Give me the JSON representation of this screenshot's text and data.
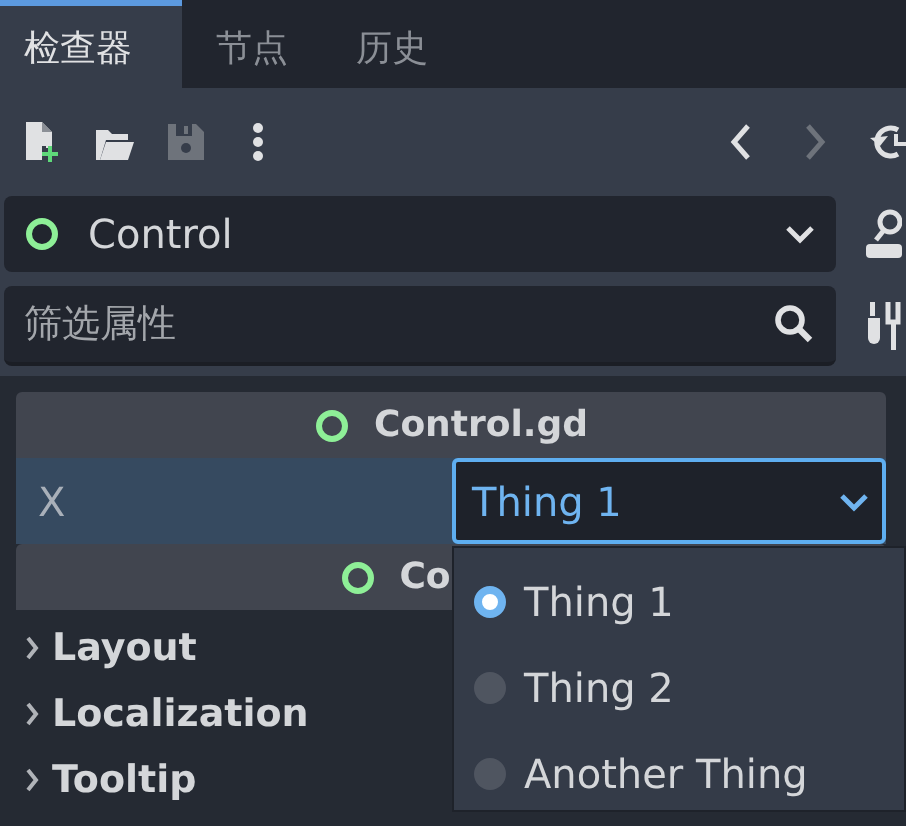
{
  "tabs": [
    {
      "label": "检查器",
      "selected": true
    },
    {
      "label": "节点",
      "selected": false
    },
    {
      "label": "历史",
      "selected": false
    }
  ],
  "toolbar": {
    "tools": [
      {
        "kind": "new",
        "disabled": false
      },
      {
        "kind": "open",
        "disabled": false
      },
      {
        "kind": "save",
        "disabled": true
      },
      {
        "kind": "more",
        "disabled": false
      }
    ],
    "nav": [
      {
        "kind": "back",
        "disabled": false
      },
      {
        "kind": "forward",
        "disabled": true
      }
    ]
  },
  "object_selector": {
    "value": "Control"
  },
  "filter": {
    "placeholder": "筛选属性"
  },
  "inspector": {
    "script_section": {
      "title": "Control.gd"
    },
    "property": {
      "label": "X",
      "value": "Thing 1",
      "focused": true
    },
    "class_section": {
      "title": "Co"
    },
    "groups": [
      {
        "label": "Layout",
        "expanded": false
      },
      {
        "label": "Localization",
        "expanded": false
      },
      {
        "label": "Tooltip",
        "expanded": false
      }
    ]
  },
  "dropdown_popup": {
    "options": [
      {
        "label": "Thing 1",
        "selected": true
      },
      {
        "label": "Thing 2",
        "selected": false
      },
      {
        "label": "Another Thing",
        "selected": false
      }
    ]
  }
}
